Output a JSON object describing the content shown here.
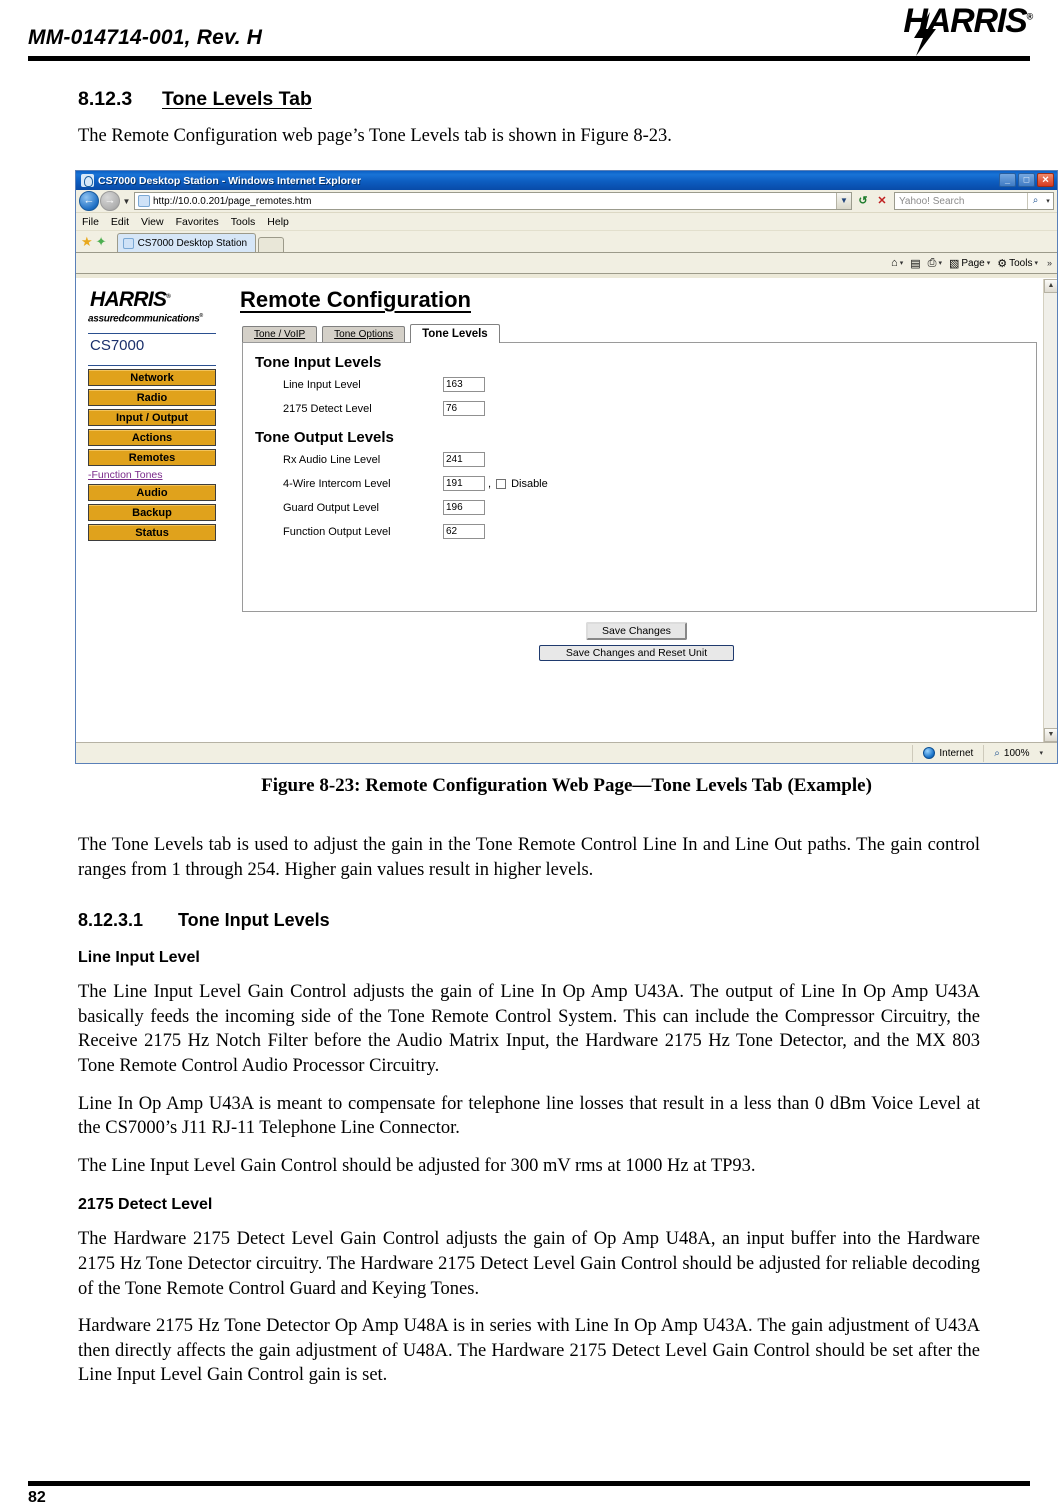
{
  "header": {
    "doc_id": "MM-014714-001, Rev. H",
    "logo": "HARRIS",
    "logo_tm": "®"
  },
  "section": {
    "number": "8.12.3",
    "title": "Tone Levels Tab",
    "intro": "The Remote Configuration web page’s Tone Levels tab is shown in Figure 8-23."
  },
  "figure": {
    "caption": "Figure 8-23:  Remote Configuration Web Page—Tone Levels Tab (Example)"
  },
  "browser": {
    "title": "CS7000 Desktop Station - Windows Internet Explorer",
    "minimize": "_",
    "maximize": "□",
    "close": "✕",
    "back_arrow": "←",
    "forward_arrow": "→",
    "history_caret": "▼",
    "url": "http://10.0.0.201/page_remotes.htm",
    "url_caret": "▼",
    "refresh_icon": "↺",
    "stop_icon": "✕",
    "search_placeholder": "Yahoo! Search",
    "search_icon": "⌕",
    "search_caret": "▾",
    "menus": [
      "File",
      "Edit",
      "View",
      "Favorites",
      "Tools",
      "Help"
    ],
    "favorites_star": "★",
    "favorites_add": "✦",
    "tab_label": "CS7000 Desktop Station",
    "command_bar": [
      {
        "label": "",
        "icon": "⌂",
        "caret": "▾",
        "name": "home-icon"
      },
      {
        "label": "",
        "icon": "▤",
        "caret": "",
        "name": "feeds-icon"
      },
      {
        "label": "",
        "icon": "⎙",
        "caret": "▾",
        "name": "print-icon"
      },
      {
        "label": "Page",
        "icon": "▧",
        "caret": "▾",
        "name": "page-menu"
      },
      {
        "label": "Tools",
        "icon": "⚙",
        "caret": "▾",
        "name": "tools-menu"
      }
    ],
    "overflow_chevron": "»",
    "scroll_up": "▲",
    "scroll_down": "▼",
    "status": {
      "zone": "Internet",
      "zoom": "100%",
      "zoom_caret": "▾"
    }
  },
  "webpage": {
    "brand": "HARRIS",
    "brand_tm": "®",
    "tagline": "assuredcommunications",
    "tagline_tm": "®",
    "device": "CS7000",
    "nav_buttons": [
      "Network",
      "Radio",
      "Input / Output",
      "Actions",
      "Remotes"
    ],
    "nav_link": "-Function Tones",
    "nav_buttons2": [
      "Audio",
      "Backup",
      "Status"
    ],
    "page_title": "Remote Configuration",
    "tabs": [
      {
        "label": "Tone / VoIP",
        "active": false
      },
      {
        "label": "Tone Options",
        "active": false
      },
      {
        "label": "Tone Levels",
        "active": true
      }
    ],
    "input_group_title": "Tone Input Levels",
    "input_fields": [
      {
        "label": "Line Input Level",
        "value": "163"
      },
      {
        "label": "2175 Detect Level",
        "value": "76"
      }
    ],
    "output_group_title": "Tone Output Levels",
    "output_fields": [
      {
        "label": "Rx Audio Line Level",
        "value": "241",
        "has_checkbox": false,
        "checkbox_label": ""
      },
      {
        "label": "4-Wire Intercom Level",
        "value": "191",
        "has_checkbox": true,
        "checkbox_label": "Disable",
        "separator": ","
      },
      {
        "label": "Guard Output Level",
        "value": "196",
        "has_checkbox": false,
        "checkbox_label": ""
      },
      {
        "label": "Function Output Level",
        "value": "62",
        "has_checkbox": false,
        "checkbox_label": ""
      }
    ],
    "save_button": "Save Changes",
    "save_reset_button": "Save Changes and Reset Unit"
  },
  "body": {
    "intro_paragraph": "The Tone Levels tab is used to adjust the gain in the Tone Remote Control Line In and Line Out paths.  The gain control ranges from 1 through 254.  Higher gain values result in higher levels.",
    "subsection": {
      "number": "8.12.3.1",
      "title": "Tone Input Levels"
    },
    "heading_line_input": "Line Input Level",
    "p1": "The Line Input Level Gain Control adjusts the gain of Line In Op Amp U43A.  The output of Line In Op Amp U43A basically feeds the incoming side of the Tone Remote Control System.  This can include the Compressor Circuitry, the Receive 2175 Hz Notch Filter before the Audio Matrix Input, the Hardware 2175 Hz Tone Detector, and the MX 803 Tone Remote Control Audio Processor Circuitry.",
    "p2": "Line In Op Amp U43A is meant to compensate for telephone line losses that result in a less than 0 dBm Voice Level at the CS7000’s J11 RJ-11 Telephone Line Connector.",
    "p3": "The Line Input Level Gain Control should be adjusted for 300 mV rms at 1000 Hz at TP93.",
    "heading_detect": "2175 Detect Level",
    "p4": "The Hardware 2175 Detect Level Gain Control adjusts the gain of Op Amp U48A, an input buffer into the Hardware 2175 Hz Tone Detector circuitry.  The Hardware 2175 Detect Level Gain Control should be adjusted for reliable decoding of the Tone Remote Control Guard and Keying Tones.",
    "p5": "Hardware 2175 Hz Tone Detector Op Amp U48A is in series with Line In Op Amp U43A.  The gain adjustment of U43A then directly affects the gain adjustment of U48A.  The Hardware 2175 Detect Level Gain Control should be set after the Line Input Level Gain Control gain is set."
  },
  "footer": {
    "page_number": "82"
  },
  "colors": {
    "nav_button": "#e0a21c",
    "title_bar": "#0d5dc0",
    "link": "#7a2a8a"
  }
}
